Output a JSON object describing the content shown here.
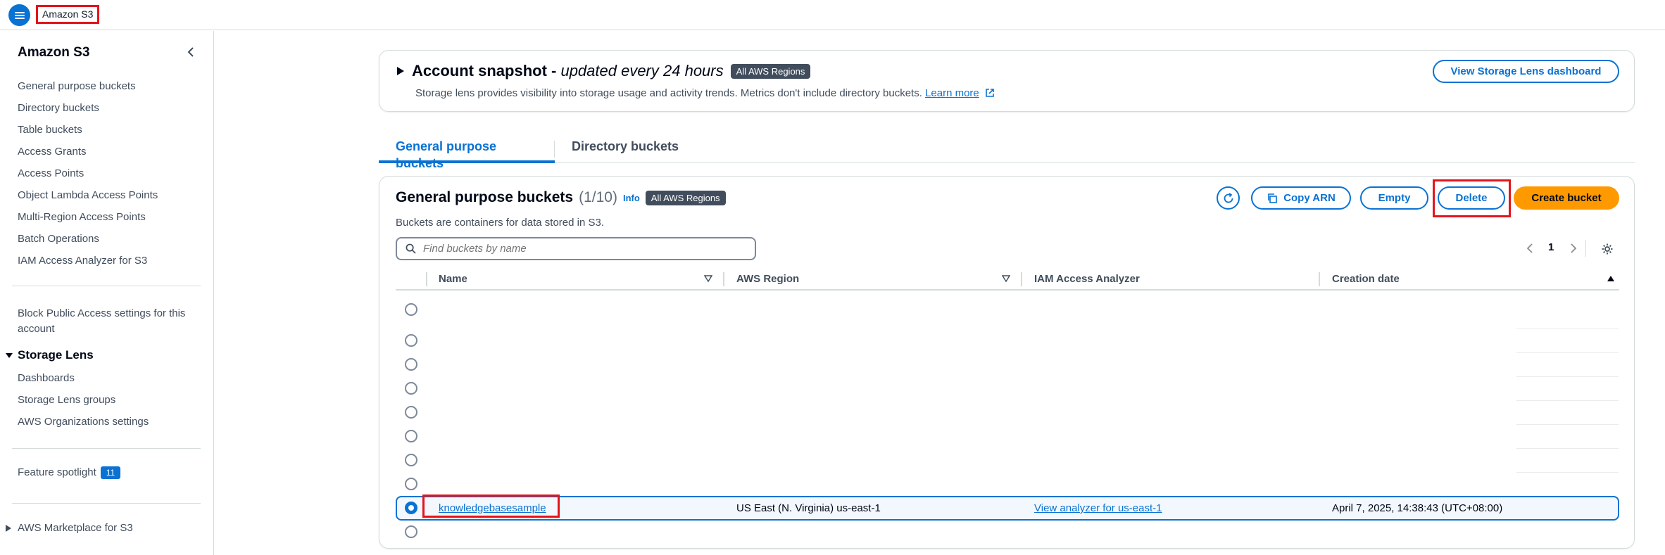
{
  "topbar": {
    "breadcrumb": "Amazon S3",
    "menu_icon": "hamburger-menu-icon",
    "accent_color": "#0972d3"
  },
  "sidebar": {
    "title": "Amazon S3",
    "links": [
      "General purpose buckets",
      "Directory buckets",
      "Table buckets",
      "Access Grants",
      "Access Points",
      "Object Lambda Access Points",
      "Multi-Region Access Points",
      "Batch Operations",
      "IAM Access Analyzer for S3"
    ],
    "block_public_access_line1": "Block Public Access settings for this",
    "block_public_access_line2": "account",
    "storage_lens": {
      "title": "Storage Lens",
      "links": [
        "Dashboards",
        "Storage Lens groups",
        "AWS Organizations settings"
      ]
    },
    "feature_spotlight": "Feature spotlight",
    "feature_spotlight_count": "11",
    "marketplace": "AWS Marketplace for S3"
  },
  "snapshot": {
    "title_bold": "Account snapshot - ",
    "title_italic": "updated every 24 hours",
    "regions_pill": "All AWS Regions",
    "description": "Storage lens provides visibility into storage usage and activity trends. Metrics don't include directory buckets.",
    "learn_more": "Learn more",
    "dashboard_button": "View Storage Lens dashboard"
  },
  "tabs": [
    {
      "label": "General purpose buckets",
      "active": true
    },
    {
      "label": "Directory buckets",
      "active": false
    }
  ],
  "buckets": {
    "title": "General purpose buckets",
    "count": "(1/10)",
    "info": "Info",
    "regions_pill": "All AWS Regions",
    "description": "Buckets are containers for data stored in S3.",
    "buttons": {
      "copy_arn": "Copy ARN",
      "empty": "Empty",
      "delete": "Delete",
      "create": "Create bucket"
    },
    "search_placeholder": "Find buckets by name",
    "page": "1",
    "columns": [
      "Name",
      "AWS Region",
      "IAM Access Analyzer",
      "Creation date"
    ],
    "selected_row": {
      "name": "knowledgebasesample",
      "region": "US East (N. Virginia) us-east-1",
      "analyzer": "View analyzer for us-east-1",
      "created": "April 7, 2025, 14:38:43 (UTC+08:00)"
    },
    "primary_color": "#ff9900"
  }
}
